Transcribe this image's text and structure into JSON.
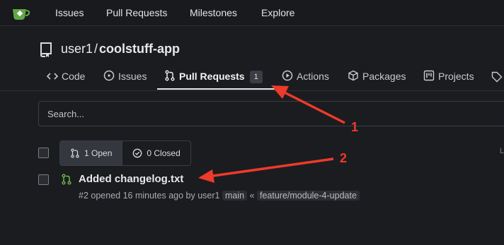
{
  "navbar": {
    "logo_icon": "gitea-tea-icon",
    "items": [
      {
        "label": "Issues"
      },
      {
        "label": "Pull Requests"
      },
      {
        "label": "Milestones"
      },
      {
        "label": "Explore"
      }
    ]
  },
  "repo": {
    "icon": "repo-icon",
    "owner": "user1",
    "separator": "/",
    "name": "coolstuff-app"
  },
  "tabs": [
    {
      "label": "Code",
      "icon": "code-icon"
    },
    {
      "label": "Issues",
      "icon": "issue-icon"
    },
    {
      "label": "Pull Requests",
      "icon": "pull-request-icon",
      "count": "1",
      "active": true
    },
    {
      "label": "Actions",
      "icon": "play-icon"
    },
    {
      "label": "Packages",
      "icon": "package-icon"
    },
    {
      "label": "Projects",
      "icon": "project-icon"
    }
  ],
  "search": {
    "placeholder": "Search...",
    "value": ""
  },
  "filters": {
    "open_label": "1 Open",
    "closed_label": "0 Closed"
  },
  "truncated_right_char": "L",
  "pull_requests": [
    {
      "title": "Added changelog.txt",
      "number": "#2",
      "opened_text": "opened 16 minutes ago by",
      "author": "user1",
      "target_branch": "main",
      "merge_symbol": "«",
      "source_branch": "feature/module-4-update"
    }
  ],
  "annotations": [
    {
      "label": "1",
      "color": "#ee3a2a"
    },
    {
      "label": "2",
      "color": "#ee3a2a"
    }
  ]
}
